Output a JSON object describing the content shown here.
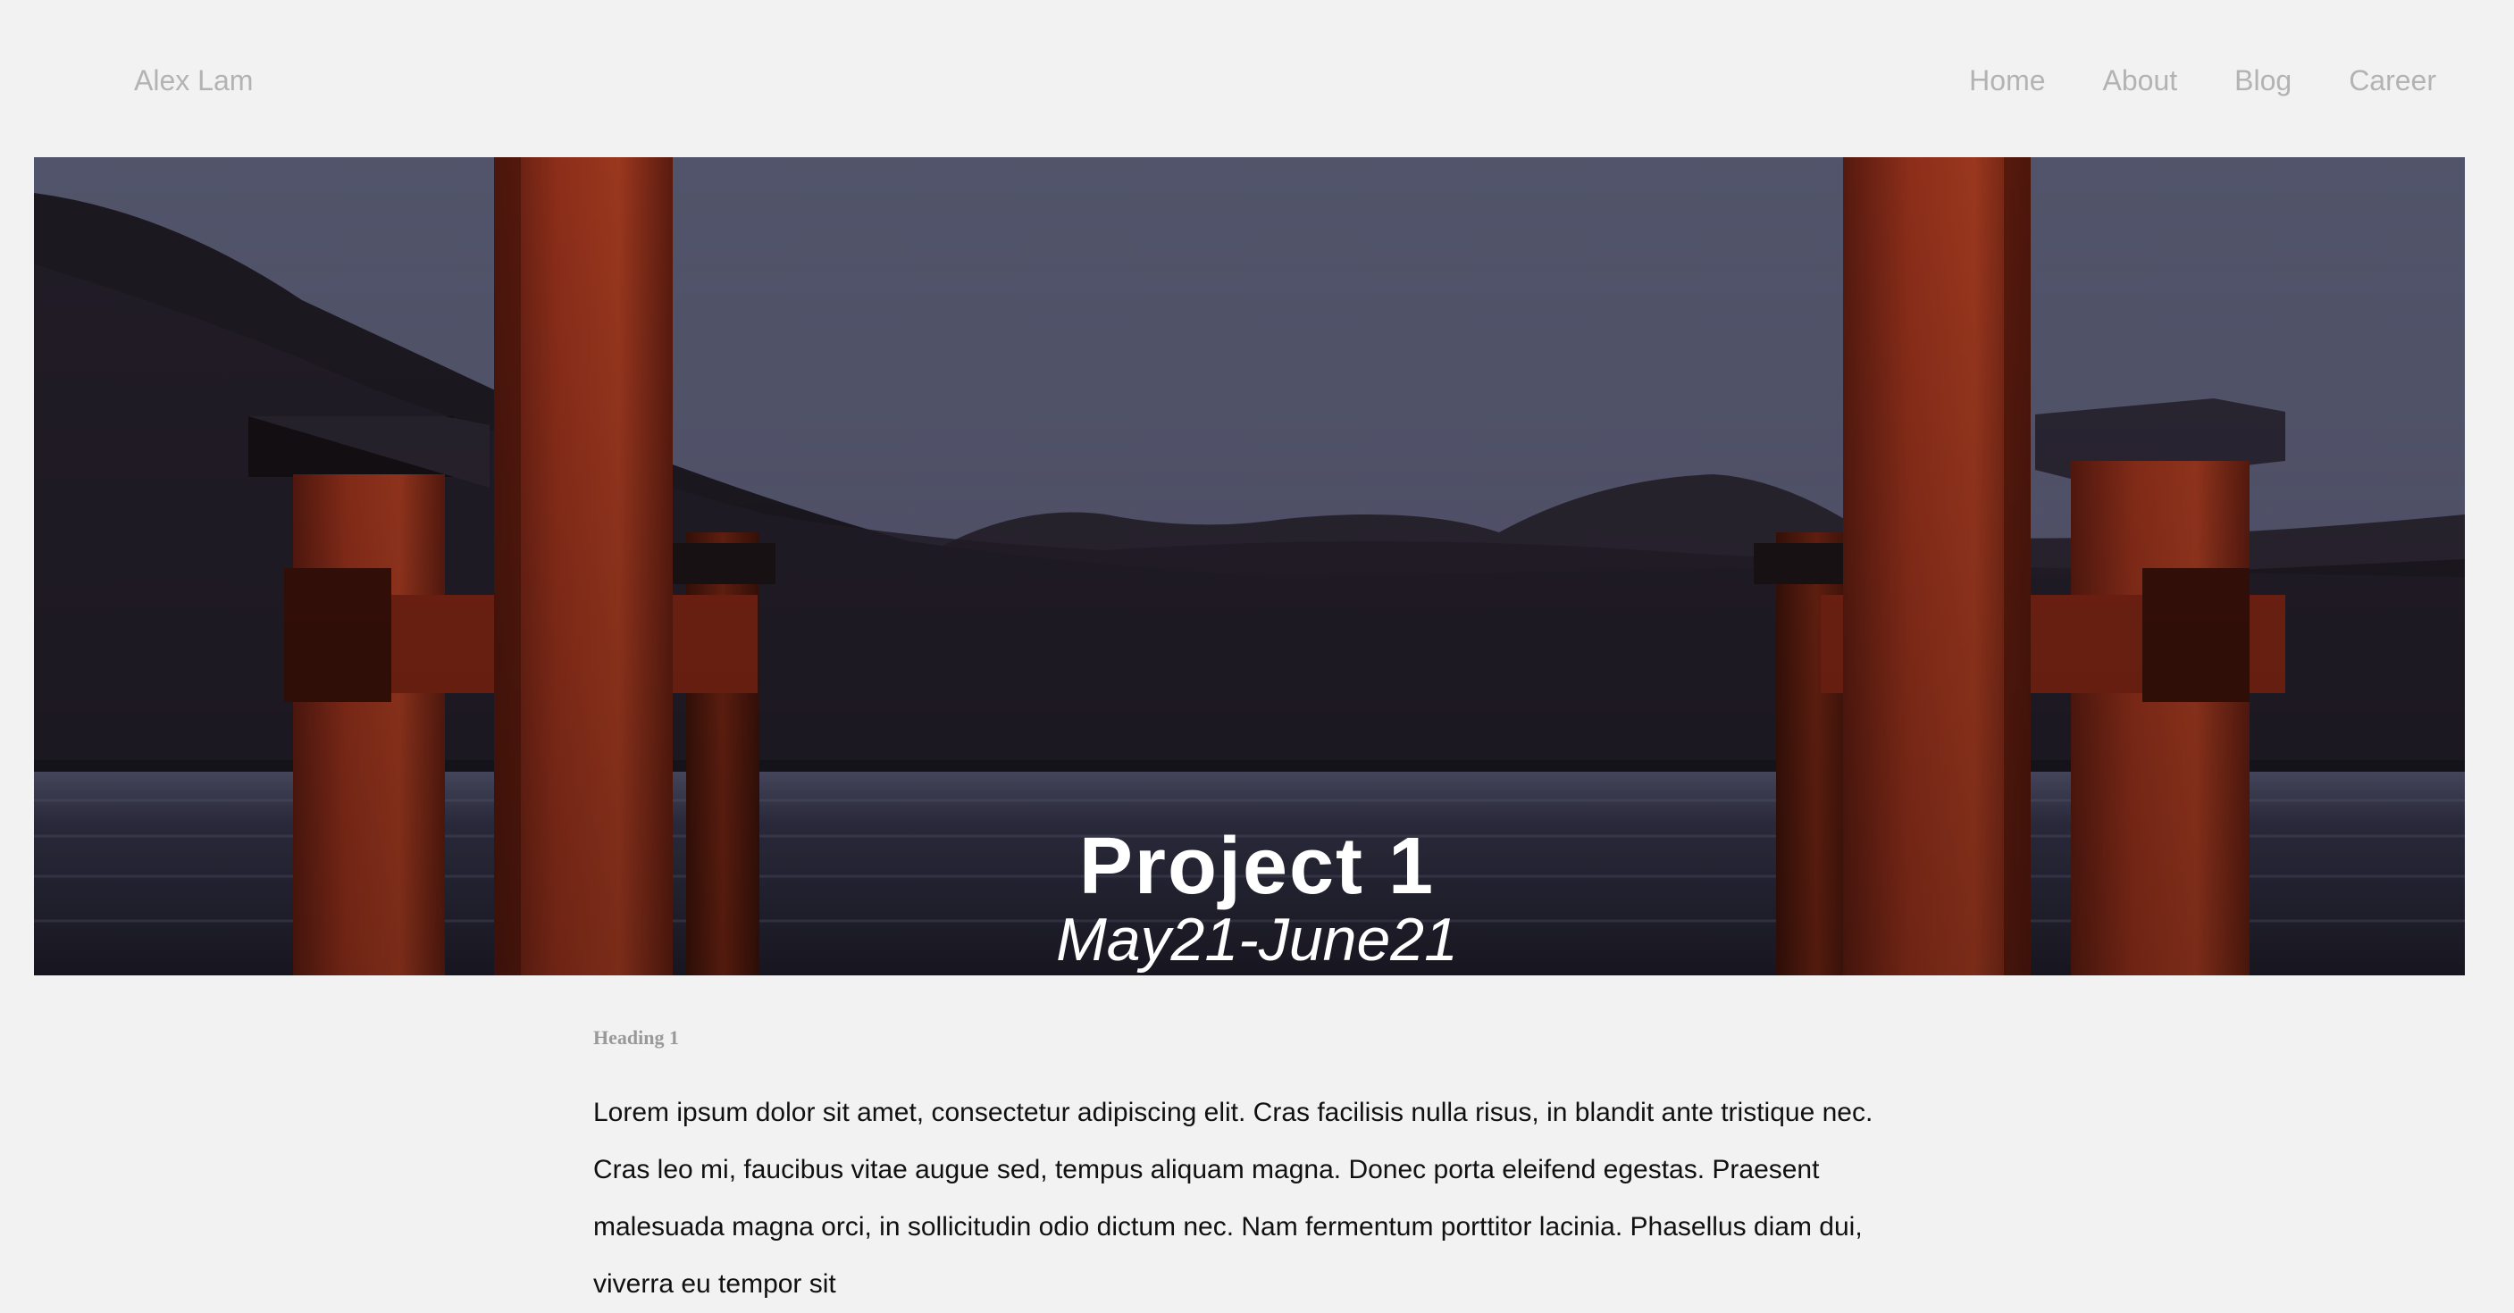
{
  "brand": "Alex Lam",
  "nav": {
    "home": "Home",
    "about": "About",
    "blog": "Blog",
    "career": "Career"
  },
  "hero": {
    "image": "torii-gate-lake-photo",
    "title": "Project 1",
    "date": "May21-June21"
  },
  "content": {
    "heading": "Heading 1",
    "paragraph": "Lorem ipsum dolor sit amet, consectetur adipiscing elit. Cras facilisis nulla risus, in blandit ante tristique nec. Cras leo mi, faucibus vitae augue sed, tempus aliquam magna. Donec porta eleifend egestas. Praesent malesuada magna orci, in sollicitudin odio dictum nec. Nam fermentum porttitor lacinia. Phasellus diam dui, viverra eu tempor sit"
  },
  "colors": {
    "background": "#f2f2f2",
    "nav_text": "#b3b3b3",
    "gate_red": "#8a2a17",
    "sky": "#5a5c78",
    "water": "#2a2a3c"
  }
}
